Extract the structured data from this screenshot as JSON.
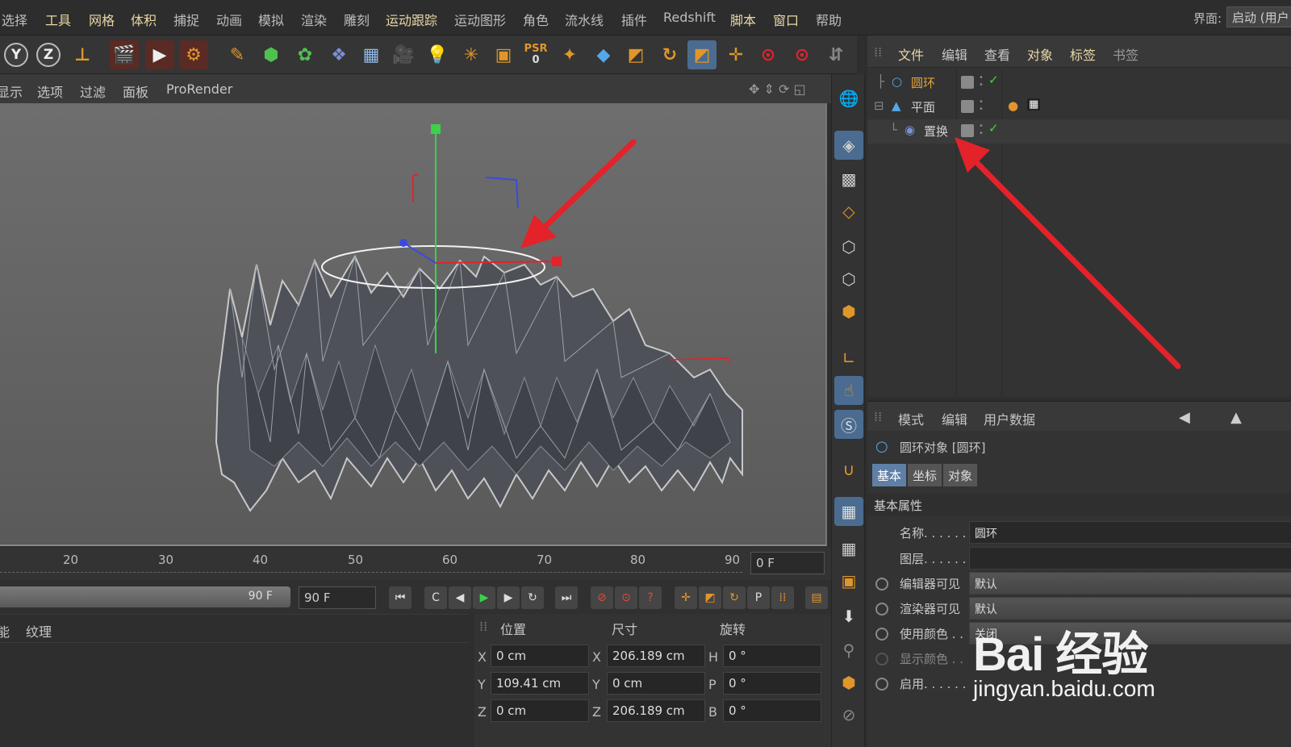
{
  "menubar": {
    "items": [
      {
        "label": "选择",
        "highlight": false
      },
      {
        "label": "工具",
        "highlight": true
      },
      {
        "label": "网格",
        "highlight": true
      },
      {
        "label": "体积",
        "highlight": true
      },
      {
        "label": "捕捉",
        "highlight": false
      },
      {
        "label": "动画",
        "highlight": false
      },
      {
        "label": "模拟",
        "highlight": false
      },
      {
        "label": "渲染",
        "highlight": false
      },
      {
        "label": "雕刻",
        "highlight": false
      },
      {
        "label": "运动跟踪",
        "highlight": true
      },
      {
        "label": "运动图形",
        "highlight": false
      },
      {
        "label": "角色",
        "highlight": false
      },
      {
        "label": "流水线",
        "highlight": false
      },
      {
        "label": "插件",
        "highlight": false
      },
      {
        "label": "Redshift",
        "highlight": false
      },
      {
        "label": "脚本",
        "highlight": true
      },
      {
        "label": "窗口",
        "highlight": true
      },
      {
        "label": "帮助",
        "highlight": false
      }
    ],
    "ui_label": "界面:",
    "ui_value": "启动 (用户"
  },
  "toolbar": {
    "y_label": "Y",
    "z_label": "Z",
    "psr_label": "PSR",
    "psr_value": "0"
  },
  "viewport": {
    "menu": [
      "显示",
      "选项",
      "过滤",
      "面板",
      "ProRender"
    ]
  },
  "timeline": {
    "ticks": [
      "20",
      "30",
      "40",
      "50",
      "60",
      "70",
      "80",
      "90"
    ],
    "current_frame": "0 F",
    "end_slider": "90 F",
    "end_frame": "90 F"
  },
  "materials": {
    "tabs": [
      "能",
      "纹理"
    ]
  },
  "coords": {
    "headers": {
      "position": "位置",
      "size": "尺寸",
      "rotation": "旋转"
    },
    "rows": [
      {
        "axis": "X",
        "pos": "0 cm",
        "size_axis": "X",
        "size": "206.189 cm",
        "rot_axis": "H",
        "rot": "0 °"
      },
      {
        "axis": "Y",
        "pos": "109.41 cm",
        "size_axis": "Y",
        "size": "0 cm",
        "rot_axis": "P",
        "rot": "0 °"
      },
      {
        "axis": "Z",
        "pos": "0 cm",
        "size_axis": "Z",
        "size": "206.189 cm",
        "rot_axis": "B",
        "rot": "0 °"
      }
    ]
  },
  "object_manager": {
    "menu": [
      {
        "label": "文件",
        "highlight": true
      },
      {
        "label": "编辑",
        "highlight": false
      },
      {
        "label": "查看",
        "highlight": false
      },
      {
        "label": "对象",
        "highlight": true
      },
      {
        "label": "标签",
        "highlight": true
      },
      {
        "label": "书签",
        "highlight": false
      }
    ],
    "objects": [
      {
        "name": "圆环",
        "color": "#e8a23a"
      },
      {
        "name": "平面",
        "color": "#cfcfcf"
      },
      {
        "name": "置换",
        "color": "#cfcfcf"
      }
    ]
  },
  "attribute_manager": {
    "menu": [
      "模式",
      "编辑",
      "用户数据"
    ],
    "title": "圆环对象 [圆环]",
    "tabs": [
      "基本",
      "坐标",
      "对象"
    ],
    "section": "基本属性",
    "fields": [
      {
        "label": "名称. . . . . .",
        "value": "圆环"
      },
      {
        "label": "图层. . . . . .",
        "value": ""
      },
      {
        "label": "编辑器可见",
        "value": "默认"
      },
      {
        "label": "渲染器可见",
        "value": "默认"
      },
      {
        "label": "使用颜色 . .",
        "value": "关闭"
      },
      {
        "label": "显示颜色 . .",
        "value": ""
      },
      {
        "label": "启用. . . . . .",
        "value": ""
      }
    ]
  },
  "watermark": {
    "brand": "Bai 经验",
    "url": "jingyan.baidu.com"
  },
  "colors": {
    "accent_blue": "#5f7fa6",
    "highlight_text": "#e8d7a6",
    "arrow_red": "#e4222a"
  }
}
